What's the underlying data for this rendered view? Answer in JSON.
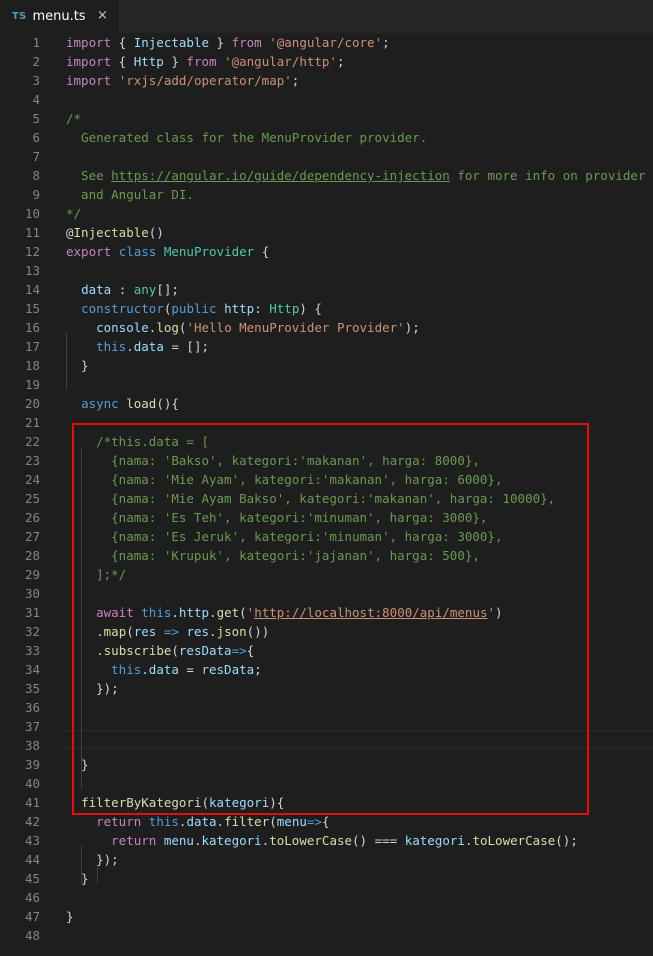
{
  "tab": {
    "icon_text": "TS",
    "file_name": "menu.ts",
    "close_glyph": "×"
  },
  "icons": {
    "typescript": "typescript-file-icon",
    "close": "close-icon"
  },
  "colors": {
    "background": "#1e1e1e",
    "keyword": "#569cd6",
    "control_keyword": "#c586c0",
    "string": "#ce9178",
    "comment": "#6a9955",
    "function": "#dcdcaa",
    "variable": "#9cdcfe",
    "type": "#4ec9b0",
    "number": "#b5cea8",
    "line_number": "#858585",
    "highlight_box": "#e01010"
  },
  "editor": {
    "lines": [
      [
        {
          "t": "import",
          "c": "kc"
        },
        {
          "t": " { ",
          "c": "pl"
        },
        {
          "t": "Injectable",
          "c": "vr"
        },
        {
          "t": " } ",
          "c": "pl"
        },
        {
          "t": "from",
          "c": "kc"
        },
        {
          "t": " ",
          "c": "pl"
        },
        {
          "t": "'@angular/core'",
          "c": "st"
        },
        {
          "t": ";",
          "c": "pl"
        }
      ],
      [
        {
          "t": "import",
          "c": "kc"
        },
        {
          "t": " { ",
          "c": "pl"
        },
        {
          "t": "Http",
          "c": "vr"
        },
        {
          "t": " } ",
          "c": "pl"
        },
        {
          "t": "from",
          "c": "kc"
        },
        {
          "t": " ",
          "c": "pl"
        },
        {
          "t": "'@angular/http'",
          "c": "st"
        },
        {
          "t": ";",
          "c": "pl"
        }
      ],
      [
        {
          "t": "import",
          "c": "kc"
        },
        {
          "t": " ",
          "c": "pl"
        },
        {
          "t": "'rxjs/add/operator/map'",
          "c": "st"
        },
        {
          "t": ";",
          "c": "pl"
        }
      ],
      [],
      [
        {
          "t": "/*",
          "c": "cm"
        }
      ],
      [
        {
          "t": "  Generated class for the MenuProvider provider.",
          "c": "cm"
        }
      ],
      [],
      [
        {
          "t": "  See ",
          "c": "cm"
        },
        {
          "t": "https://angular.io/guide/dependency-injection",
          "c": "cm ul"
        },
        {
          "t": " for more info on provider",
          "c": "cm"
        }
      ],
      [
        {
          "t": "  and Angular DI.",
          "c": "cm"
        }
      ],
      [
        {
          "t": "*/",
          "c": "cm"
        }
      ],
      [
        {
          "t": "@",
          "c": "pl"
        },
        {
          "t": "Injectable",
          "c": "fn"
        },
        {
          "t": "()",
          "c": "pl"
        }
      ],
      [
        {
          "t": "export",
          "c": "kc"
        },
        {
          "t": " ",
          "c": "pl"
        },
        {
          "t": "class",
          "c": "kw"
        },
        {
          "t": " ",
          "c": "pl"
        },
        {
          "t": "MenuProvider",
          "c": "ty"
        },
        {
          "t": " {",
          "c": "pl"
        }
      ],
      [],
      [
        {
          "t": "  ",
          "c": "pl"
        },
        {
          "t": "data",
          "c": "vr"
        },
        {
          "t": " : ",
          "c": "pl"
        },
        {
          "t": "any",
          "c": "ty"
        },
        {
          "t": "[];",
          "c": "pl"
        }
      ],
      [
        {
          "t": "  ",
          "c": "pl"
        },
        {
          "t": "constructor",
          "c": "kw"
        },
        {
          "t": "(",
          "c": "pl"
        },
        {
          "t": "public",
          "c": "kw"
        },
        {
          "t": " ",
          "c": "pl"
        },
        {
          "t": "http",
          "c": "vr"
        },
        {
          "t": ": ",
          "c": "pl"
        },
        {
          "t": "Http",
          "c": "ty"
        },
        {
          "t": ") {",
          "c": "pl"
        }
      ],
      [
        {
          "t": "    ",
          "c": "pl"
        },
        {
          "t": "console",
          "c": "vr"
        },
        {
          "t": ".",
          "c": "pl"
        },
        {
          "t": "log",
          "c": "fn"
        },
        {
          "t": "(",
          "c": "pl"
        },
        {
          "t": "'Hello MenuProvider Provider'",
          "c": "st"
        },
        {
          "t": ");",
          "c": "pl"
        }
      ],
      [
        {
          "t": "    ",
          "c": "pl"
        },
        {
          "t": "this",
          "c": "kw"
        },
        {
          "t": ".",
          "c": "pl"
        },
        {
          "t": "data",
          "c": "vr"
        },
        {
          "t": " = [];",
          "c": "pl"
        }
      ],
      [
        {
          "t": "  }",
          "c": "pl"
        }
      ],
      [],
      [
        {
          "t": "  ",
          "c": "pl"
        },
        {
          "t": "async",
          "c": "kw"
        },
        {
          "t": " ",
          "c": "pl"
        },
        {
          "t": "load",
          "c": "fn"
        },
        {
          "t": "(){",
          "c": "pl"
        }
      ],
      [],
      [
        {
          "t": "    /*this.data = [",
          "c": "cm"
        }
      ],
      [
        {
          "t": "      {nama: 'Bakso', kategori:'makanan', harga: 8000},",
          "c": "cm"
        }
      ],
      [
        {
          "t": "      {nama: 'Mie Ayam', kategori:'makanan', harga: 6000},",
          "c": "cm"
        }
      ],
      [
        {
          "t": "      {nama: 'Mie Ayam Bakso', kategori:'makanan', harga: 10000},",
          "c": "cm"
        }
      ],
      [
        {
          "t": "      {nama: 'Es Teh', kategori:'minuman', harga: 3000},",
          "c": "cm"
        }
      ],
      [
        {
          "t": "      {nama: 'Es Jeruk', kategori:'minuman', harga: 3000},",
          "c": "cm"
        }
      ],
      [
        {
          "t": "      {nama: 'Krupuk', kategori:'jajanan', harga: 500},",
          "c": "cm"
        }
      ],
      [
        {
          "t": "    ];*/",
          "c": "cm"
        }
      ],
      [],
      [
        {
          "t": "    ",
          "c": "pl"
        },
        {
          "t": "await",
          "c": "kc"
        },
        {
          "t": " ",
          "c": "pl"
        },
        {
          "t": "this",
          "c": "kw"
        },
        {
          "t": ".",
          "c": "pl"
        },
        {
          "t": "http",
          "c": "vr"
        },
        {
          "t": ".",
          "c": "pl"
        },
        {
          "t": "get",
          "c": "fn"
        },
        {
          "t": "(",
          "c": "pl"
        },
        {
          "t": "'",
          "c": "st"
        },
        {
          "t": "http://localhost:8000/api/menus",
          "c": "st ul"
        },
        {
          "t": "'",
          "c": "st"
        },
        {
          "t": ")",
          "c": "pl"
        }
      ],
      [
        {
          "t": "    .",
          "c": "pl"
        },
        {
          "t": "map",
          "c": "fn"
        },
        {
          "t": "(",
          "c": "pl"
        },
        {
          "t": "res",
          "c": "vr"
        },
        {
          "t": " ",
          "c": "pl"
        },
        {
          "t": "=>",
          "c": "kw"
        },
        {
          "t": " ",
          "c": "pl"
        },
        {
          "t": "res",
          "c": "vr"
        },
        {
          "t": ".",
          "c": "pl"
        },
        {
          "t": "json",
          "c": "fn"
        },
        {
          "t": "())",
          "c": "pl"
        }
      ],
      [
        {
          "t": "    .",
          "c": "pl"
        },
        {
          "t": "subscribe",
          "c": "fn"
        },
        {
          "t": "(",
          "c": "pl"
        },
        {
          "t": "resData",
          "c": "vr"
        },
        {
          "t": "=>",
          "c": "kw"
        },
        {
          "t": "{",
          "c": "pl"
        }
      ],
      [
        {
          "t": "      ",
          "c": "pl"
        },
        {
          "t": "this",
          "c": "kw"
        },
        {
          "t": ".",
          "c": "pl"
        },
        {
          "t": "data",
          "c": "vr"
        },
        {
          "t": " = ",
          "c": "pl"
        },
        {
          "t": "resData",
          "c": "vr"
        },
        {
          "t": ";",
          "c": "pl"
        }
      ],
      [
        {
          "t": "    });",
          "c": "pl"
        }
      ],
      [],
      [],
      [],
      [
        {
          "t": "  }",
          "c": "pl"
        }
      ],
      [],
      [
        {
          "t": "  ",
          "c": "pl"
        },
        {
          "t": "filterByKategori",
          "c": "fn"
        },
        {
          "t": "(",
          "c": "pl"
        },
        {
          "t": "kategori",
          "c": "vr"
        },
        {
          "t": "){",
          "c": "pl"
        }
      ],
      [
        {
          "t": "    ",
          "c": "pl"
        },
        {
          "t": "return",
          "c": "kc"
        },
        {
          "t": " ",
          "c": "pl"
        },
        {
          "t": "this",
          "c": "kw"
        },
        {
          "t": ".",
          "c": "pl"
        },
        {
          "t": "data",
          "c": "vr"
        },
        {
          "t": ".",
          "c": "pl"
        },
        {
          "t": "filter",
          "c": "fn"
        },
        {
          "t": "(",
          "c": "pl"
        },
        {
          "t": "menu",
          "c": "vr"
        },
        {
          "t": "=>",
          "c": "kw"
        },
        {
          "t": "{",
          "c": "pl"
        }
      ],
      [
        {
          "t": "      ",
          "c": "pl"
        },
        {
          "t": "return",
          "c": "kc"
        },
        {
          "t": " ",
          "c": "pl"
        },
        {
          "t": "menu",
          "c": "vr"
        },
        {
          "t": ".",
          "c": "pl"
        },
        {
          "t": "kategori",
          "c": "vr"
        },
        {
          "t": ".",
          "c": "pl"
        },
        {
          "t": "toLowerCase",
          "c": "fn"
        },
        {
          "t": "() === ",
          "c": "pl"
        },
        {
          "t": "kategori",
          "c": "vr"
        },
        {
          "t": ".",
          "c": "pl"
        },
        {
          "t": "toLowerCase",
          "c": "fn"
        },
        {
          "t": "();",
          "c": "pl"
        }
      ],
      [
        {
          "t": "    });",
          "c": "pl"
        }
      ],
      [
        {
          "t": "  }",
          "c": "pl"
        }
      ],
      [],
      [
        {
          "t": "}",
          "c": "pl"
        }
      ],
      []
    ]
  }
}
